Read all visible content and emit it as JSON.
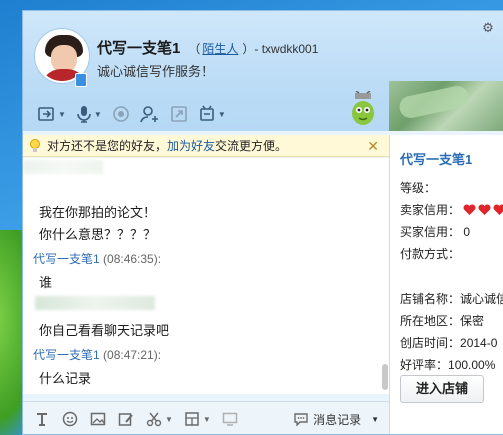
{
  "contact": {
    "name": "代写一支笔1",
    "separator": "（",
    "relation": "陌生人",
    "id_suffix": "）- txwdkk001",
    "signature": "诚心诚信写作服务！"
  },
  "toolbar": {
    "icons": [
      "file-transfer-icon",
      "voice-call-icon",
      "video-call-icon",
      "add-contact-icon",
      "share-screen-icon",
      "remote-assist-icon"
    ]
  },
  "notice": {
    "text_before": "对方还不是您的好友，",
    "link": "加为好友",
    "text_after": "交流更方便。",
    "close": "✕"
  },
  "messages": [
    {
      "text": "我在你那拍的论文！"
    },
    {
      "text": "你什么意思？？？？"
    },
    {
      "sender": "代写一支笔1",
      "time": " (08:46:35):"
    },
    {
      "text": "谁"
    },
    {
      "text": "你自己看看聊天记录吧"
    },
    {
      "sender": "代写一支笔1",
      "time": " (08:47:21):"
    },
    {
      "text": "什么记录"
    }
  ],
  "bottom_bar": {
    "history_label": "消息记录"
  },
  "shop": {
    "title": "代写一支笔1",
    "level_label": "等级：",
    "seller_label": "卖家信用：",
    "buyer_label": "买家信用：",
    "buyer_value": "0",
    "payment_label": "付款方式：",
    "shop_name_label": "店铺名称：",
    "shop_name_value": "诚心诚信",
    "region_label": "所在地区：",
    "region_value": "保密",
    "created_label": "创店时间：",
    "created_value": "2014-0",
    "rating_label": "好评率：",
    "rating_value": "100.00%",
    "enter_button": "进入店铺"
  },
  "colors": {
    "link": "#1a5aa0",
    "sender": "#2e6db4",
    "shop_title": "#2a6db6",
    "heart": "#e0262b"
  }
}
